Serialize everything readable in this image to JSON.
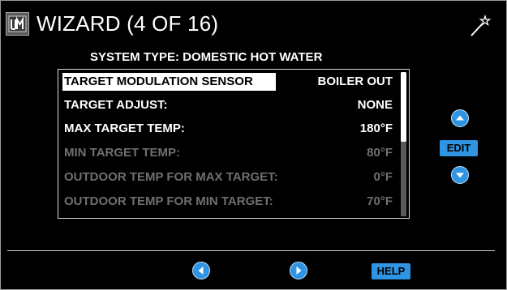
{
  "header": {
    "title": "WIZARD (4 OF 16)",
    "logo_icon": "um-logo-icon",
    "wand_icon": "magic-wand-icon"
  },
  "system_type": "SYSTEM TYPE: DOMESTIC HOT WATER",
  "settings": [
    {
      "label": "TARGET MODULATION SENSOR",
      "value": "BOILER OUT",
      "state": "selected"
    },
    {
      "label": "TARGET ADJUST:",
      "value": "NONE",
      "state": "enabled"
    },
    {
      "label": "MAX TARGET TEMP:",
      "value": "180°F",
      "state": "enabled"
    },
    {
      "label": "MIN TARGET TEMP:",
      "value": "80°F",
      "state": "disabled"
    },
    {
      "label": "OUTDOOR TEMP FOR MAX TARGET:",
      "value": "0°F",
      "state": "disabled"
    },
    {
      "label": "OUTDOOR TEMP FOR MIN TARGET:",
      "value": "70°F",
      "state": "disabled"
    }
  ],
  "side_controls": {
    "edit_label": "EDIT",
    "up_icon": "chevron-up-icon",
    "down_icon": "chevron-down-icon"
  },
  "footer": {
    "help_label": "HELP",
    "prev_icon": "chevron-left-icon",
    "next_icon": "chevron-right-icon"
  },
  "colors": {
    "background": "#000000",
    "accent": "#2f95e2",
    "text": "#ffffff",
    "disabled_text": "#6f6f6f"
  }
}
